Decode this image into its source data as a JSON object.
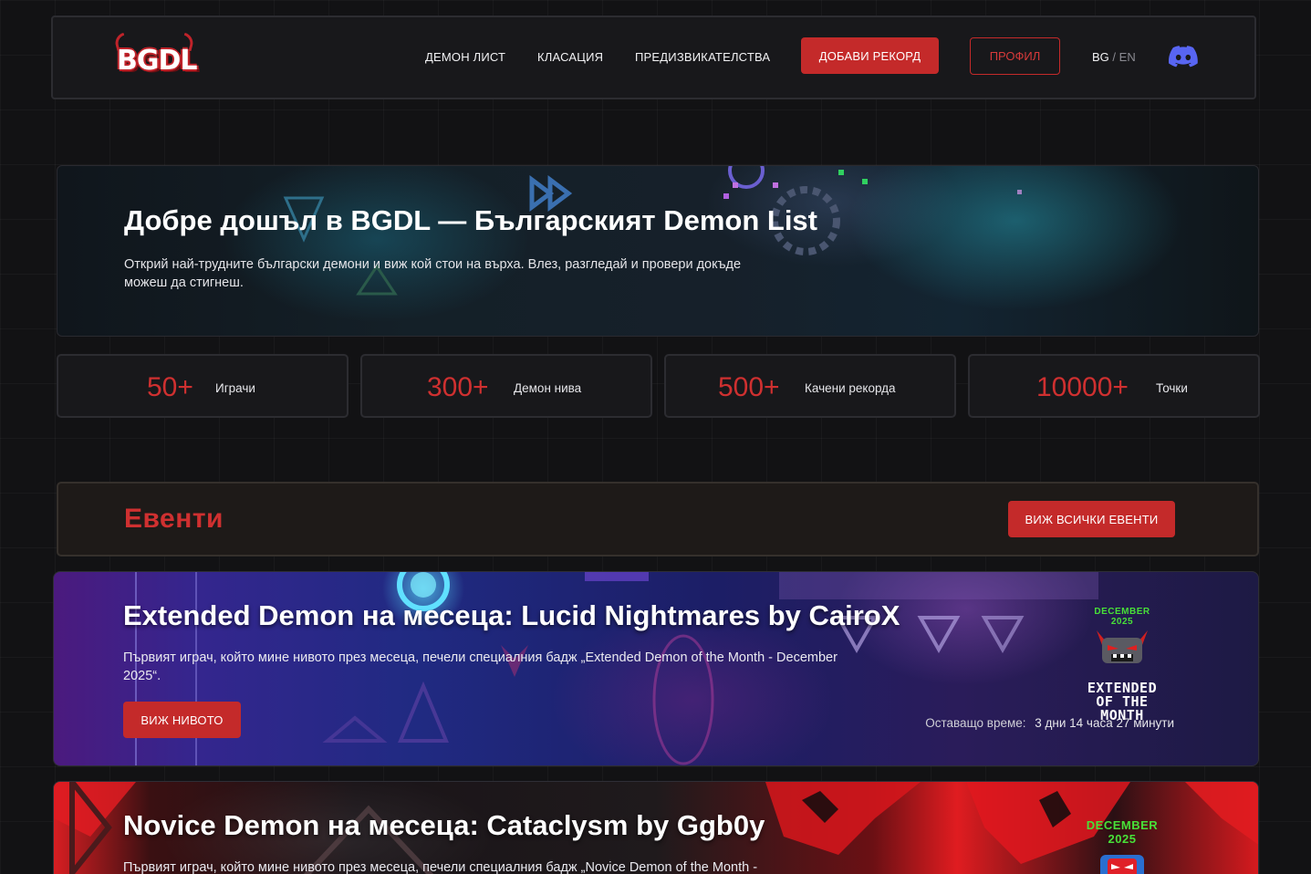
{
  "nav": {
    "logo_text": "BGDL",
    "links": [
      "ДЕМОН ЛИСТ",
      "КЛАСАЦИЯ",
      "ПРЕДИЗВИКАТЕЛСТВА"
    ],
    "add_record": "ДОБАВИ РЕКОРД",
    "profile": "ПРОФИЛ",
    "lang_active": "BG",
    "lang_sep": "/",
    "lang_alt": "EN",
    "discord_icon": "discord-icon"
  },
  "hero": {
    "title": "Добре дошъл в BGDL — Българският Demon List",
    "subtitle": "Открий най-трудните български демони и виж кой стои на върха. Влез, разгледай и провери докъде можеш да стигнеш."
  },
  "stats": [
    {
      "value": "50+",
      "label": "Играчи"
    },
    {
      "value": "300+",
      "label": "Демон нива"
    },
    {
      "value": "500+",
      "label": "Качени рекорда"
    },
    {
      "value": "10000+",
      "label": "Точки"
    }
  ],
  "events": {
    "title": "Евенти",
    "view_all": "ВИЖ ВСИЧКИ ЕВЕНТИ",
    "cards": [
      {
        "title": "Extended Demon на месеца: Lucid Nightmares by CairoX",
        "description": "Първият играч, който мине нивото през месеца, печели специалния бадж „Extended Demon of the Month - December 2025“.",
        "button": "ВИЖ НИВОТО",
        "badge_month": "DECEMBER",
        "badge_year": "2025",
        "badge_line1": "EXTENDED",
        "badge_line2": "OF THE MONTH",
        "remaining_label": "Оставащо време:",
        "remaining_value": "3 дни 14 часа 27 минути"
      },
      {
        "title": "Novice Demon на месеца: Cataclysm by Ggb0y",
        "description": "Първият играч, който мине нивото през месеца, печели специалния бадж „Novice Demon of the Month -",
        "badge_month": "DECEMBER",
        "badge_year": "2025"
      }
    ]
  },
  "colors": {
    "accent": "#c42a2a",
    "stat_value": "#cf3030",
    "badge_green": "#48e038",
    "discord": "#5865f2"
  }
}
